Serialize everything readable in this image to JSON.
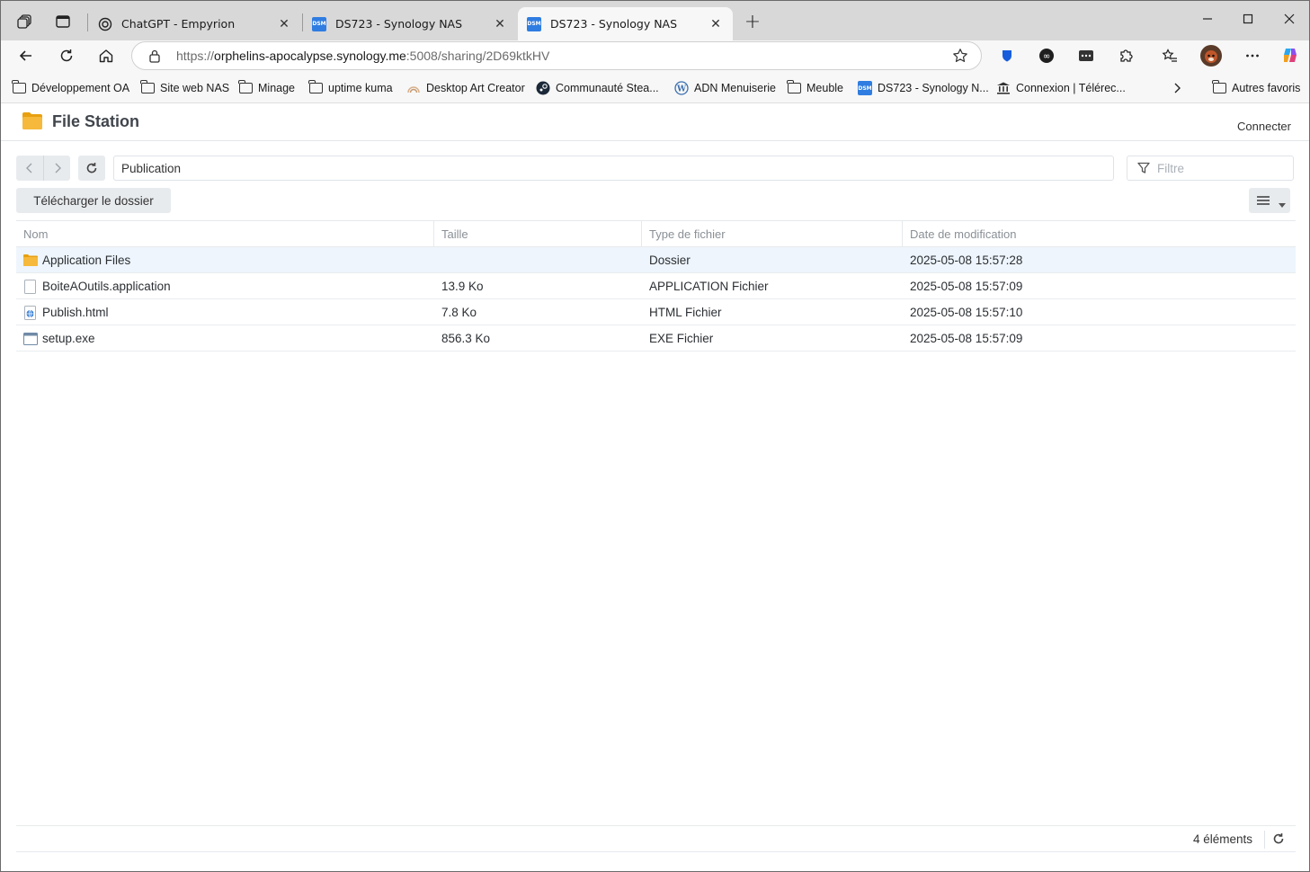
{
  "browser": {
    "tabs": [
      {
        "title": "ChatGPT - Empyrion",
        "icon": "chatgpt-icon"
      },
      {
        "title": "DS723 - Synology NAS",
        "icon": "dsm-icon"
      },
      {
        "title": "DS723 - Synology NAS",
        "icon": "dsm-icon",
        "active": true
      }
    ],
    "new_tab_label": "+",
    "url_prefix": "https://",
    "url_host": "orphelins-apocalypse.synology.me",
    "url_rest": ":5008/sharing/2D69ktkHV",
    "bookmarks": [
      {
        "label": "Développement OA",
        "icon": "folder-icon"
      },
      {
        "label": "Site web NAS",
        "icon": "folder-icon"
      },
      {
        "label": "Minage",
        "icon": "folder-icon"
      },
      {
        "label": "uptime kuma",
        "icon": "folder-icon"
      },
      {
        "label": "Desktop Art Creator",
        "icon": "rainbow-icon"
      },
      {
        "label": "Communauté Stea...",
        "icon": "steam-icon"
      },
      {
        "label": "ADN Menuiserie",
        "icon": "wordpress-icon"
      },
      {
        "label": "Meuble",
        "icon": "folder-icon"
      },
      {
        "label": "DS723 - Synology N...",
        "icon": "dsm-icon"
      },
      {
        "label": "Connexion | Télérec...",
        "icon": "bank-icon"
      }
    ],
    "other_favorites": "Autres favoris",
    "dsm_badge": "DSM"
  },
  "app": {
    "title": "File Station",
    "connect_label": "Connecter",
    "path": "Publication",
    "filter_placeholder": "Filtre",
    "download_label": "Télécharger le dossier",
    "columns": [
      "Nom",
      "Taille",
      "Type de fichier",
      "Date de modification"
    ],
    "files": [
      {
        "name": "Application Files",
        "size": "",
        "type": "Dossier",
        "date": "2025-05-08 15:57:28",
        "icon": "folder-icon"
      },
      {
        "name": "BoiteAOutils.application",
        "size": "13.9 Ko",
        "type": "APPLICATION Fichier",
        "date": "2025-05-08 15:57:09",
        "icon": "file-icon"
      },
      {
        "name": "Publish.html",
        "size": "7.8 Ko",
        "type": "HTML Fichier",
        "date": "2025-05-08 15:57:10",
        "icon": "html-file-icon"
      },
      {
        "name": "setup.exe",
        "size": "856.3 Ko",
        "type": "EXE Fichier",
        "date": "2025-05-08 15:57:09",
        "icon": "exe-file-icon"
      }
    ],
    "item_count": "4 éléments"
  },
  "colors": {
    "accent": "#2f7de1",
    "selected_row": "#eef5fc",
    "folder": "#f6b93b"
  }
}
